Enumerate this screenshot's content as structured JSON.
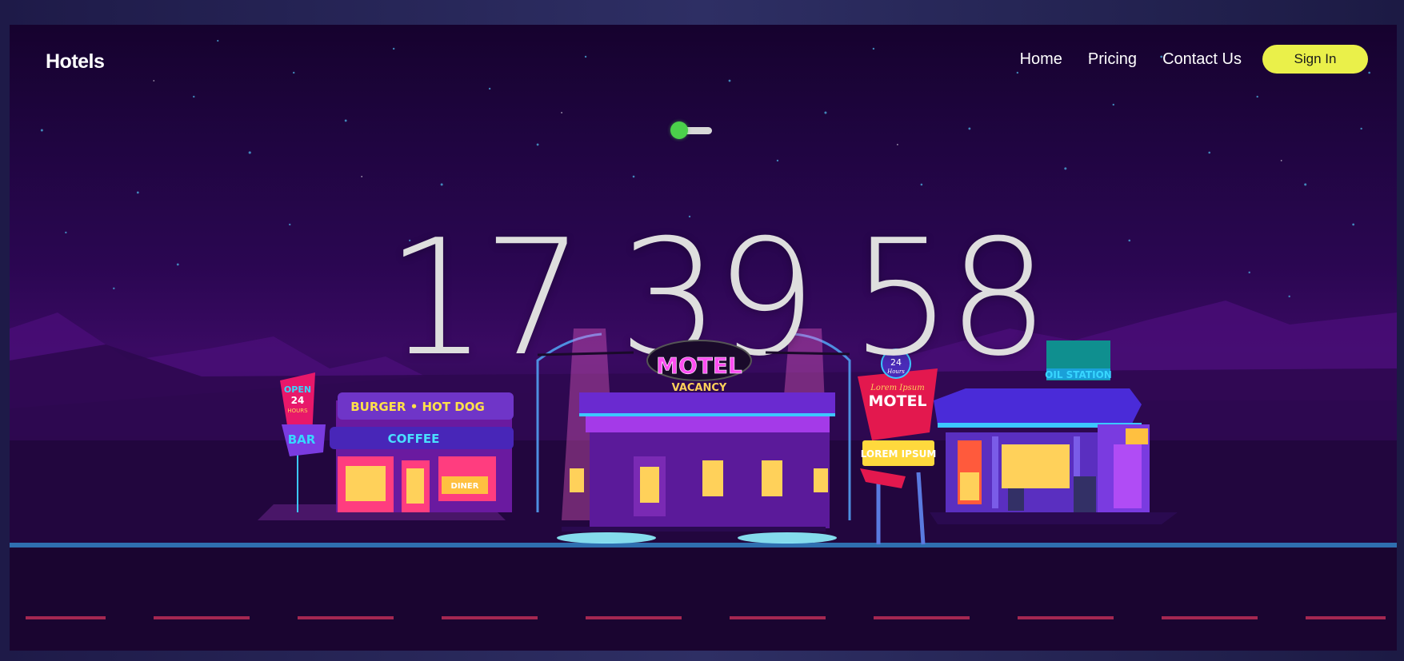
{
  "nav": {
    "brand": "Hotels",
    "links": [
      "Home",
      "Pricing",
      "Contact Us"
    ],
    "signin_label": "Sign In"
  },
  "toggle": {
    "state": "on",
    "knob_color": "#4bd04b"
  },
  "clock": {
    "hours": "17",
    "minutes": "39",
    "seconds": "58"
  },
  "scene": {
    "burger_sign": "BURGER • HOT DOG",
    "coffee_sign": "COFFEE",
    "diner_sign": "DINER",
    "bar_sign_top": "OPEN",
    "bar_sign_hours_num": "24",
    "bar_sign_hours": "HOURS",
    "bar_sign_bar": "BAR",
    "motel_sign": "MOTEL",
    "vacancy_sign": "VACANCY",
    "motel2_small": "Lorem Ipsum",
    "motel2_sign": "MOTEL",
    "lorem_sign": "LOREM IPSUM",
    "hours_badge_num": "24",
    "hours_badge_text": "Hours",
    "oil_sign": "OIL STATION"
  },
  "colors": {
    "accent": "#eaf04a",
    "neon_pink": "#ff3df0",
    "neon_cyan": "#37d6ff",
    "neon_yellow": "#ffd93d"
  }
}
